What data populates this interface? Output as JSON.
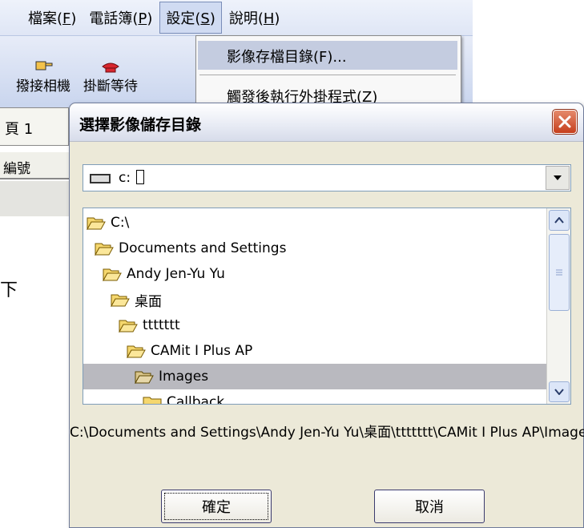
{
  "menubar": {
    "items": [
      "檔案(",
      "電話簿(",
      "設定(",
      "說明("
    ],
    "keys": [
      "F",
      "P",
      "S",
      "H"
    ],
    "close_paren": ")"
  },
  "toolbar": {
    "buttons": [
      {
        "label": "撥接相機",
        "icon": "hand-icon"
      },
      {
        "label": "掛斷等待",
        "icon": "phone-icon"
      }
    ]
  },
  "background": {
    "tab_label": "頁 1",
    "column_header": "編號",
    "side_text": "下"
  },
  "dropdown": {
    "item1": "影像存檔目錄(F)...",
    "item2_partial": "觸發後執行外掛程式(Z)"
  },
  "dialog": {
    "title": "選擇影像儲存目錄",
    "drive_value": "c: ",
    "folders": [
      {
        "name": "C:\\",
        "level": 0,
        "open": true
      },
      {
        "name": "Documents and Settings",
        "level": 1,
        "open": true
      },
      {
        "name": "Andy Jen-Yu Yu",
        "level": 2,
        "open": true
      },
      {
        "name": "桌面",
        "level": 3,
        "open": true
      },
      {
        "name": "ttttttt",
        "level": 4,
        "open": true
      },
      {
        "name": "CAMit I Plus AP",
        "level": 5,
        "open": true
      },
      {
        "name": "Images",
        "level": 6,
        "open": true,
        "selected": true
      },
      {
        "name": "Callback",
        "level": 7,
        "open": false
      }
    ],
    "path": "C:\\Documents and Settings\\Andy Jen-Yu Yu\\桌面\\ttttttt\\CAMit I Plus AP\\Images",
    "ok_label": "確定",
    "cancel_label": "取消"
  },
  "colors": {
    "selection": "#b9b9bf",
    "dialog_bg": "#ece9d8",
    "close_red": "#c63f1d",
    "folder_yellow": "#f5d76e"
  }
}
